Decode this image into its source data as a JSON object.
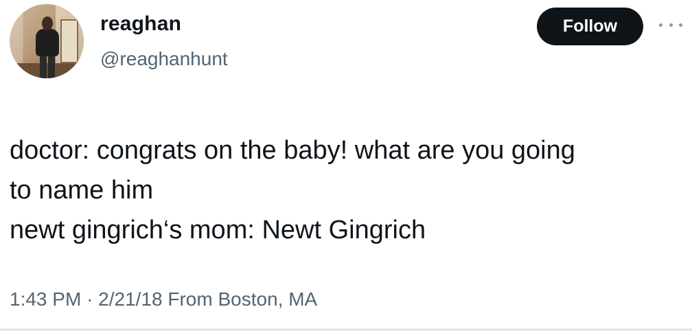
{
  "author": {
    "display_name": "reaghan",
    "handle": "@reaghanhunt",
    "avatar_icon": "profile-photo"
  },
  "actions": {
    "follow_label": "Follow",
    "more_icon": "more-horizontal-icon"
  },
  "tweet": {
    "lines": [
      "doctor: congrats on the baby! what are you going",
      "to name him",
      "newt gingrich‘s mom: Newt Gingrich"
    ]
  },
  "meta": {
    "time": "1:43 PM",
    "separator": "·",
    "date": "2/21/18",
    "location": "From Boston, MA"
  },
  "colors": {
    "text_primary": "#0f1419",
    "text_secondary": "#536471",
    "follow_bg": "#0f1419",
    "follow_text": "#ffffff"
  }
}
